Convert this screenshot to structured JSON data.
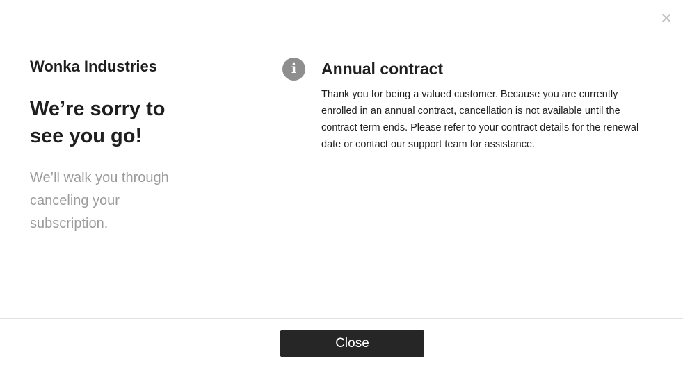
{
  "dialog": {
    "close_icon": "close-icon",
    "company_name": "Wonka Industries",
    "headline": "We’re sorry to see you go!",
    "subtext": "We’ll walk you through canceling your subscription.",
    "notice": {
      "icon": "info-icon",
      "icon_glyph": "i",
      "title": "Annual contract",
      "body": "Thank you for being a valued customer. Because you are currently enrolled in an annual contract, cancellation is not available until the contract term ends. Please refer to your contract details for the renewal date or contact our support team for assistance."
    },
    "close_button_label": "Close"
  },
  "colors": {
    "button_bg": "#262626",
    "muted_text": "#9b9b9b",
    "icon_bg": "#8e8e8e",
    "divider": "#dcdcdc"
  }
}
